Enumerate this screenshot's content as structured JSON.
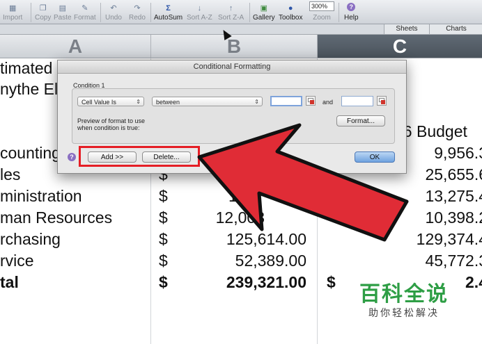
{
  "toolbar": {
    "items": [
      {
        "label": "Import",
        "icon": "import-icon"
      },
      {
        "label": "Copy",
        "icon": "copy-icon"
      },
      {
        "label": "Paste",
        "icon": "paste-icon"
      },
      {
        "label": "Format",
        "icon": "format-brush-icon"
      },
      {
        "label": "Undo",
        "icon": "undo-icon"
      },
      {
        "label": "Redo",
        "icon": "redo-icon"
      },
      {
        "label": "AutoSum",
        "icon": "sigma-icon"
      },
      {
        "label": "Sort A-Z",
        "icon": "sort-az-icon"
      },
      {
        "label": "Sort Z-A",
        "icon": "sort-za-icon"
      },
      {
        "label": "Gallery",
        "icon": "gallery-icon"
      },
      {
        "label": "Toolbox",
        "icon": "toolbox-icon"
      },
      {
        "label": "Zoom",
        "value": "300%"
      },
      {
        "label": "Help",
        "icon": "help-icon"
      }
    ]
  },
  "ribbon_tabs": [
    "Sheets",
    "Charts"
  ],
  "columns": [
    "A",
    "B",
    "C"
  ],
  "sheet": {
    "a_col": [
      "timated",
      "nythe El",
      "counting",
      "les",
      "ministration",
      "man Resources",
      "rchasing",
      "rvice",
      "tal"
    ],
    "b_dollar": "$",
    "b_values": [
      "13,",
      "12,003",
      "125,614.00",
      "52,389.00",
      "239,321.00"
    ],
    "c_header": "06 Budget",
    "c_values": [
      "9,956.3",
      "25,655.6",
      "13,275.4",
      "10,398.2",
      "129,374.4",
      "45,772.3",
      "2.4"
    ]
  },
  "dialog": {
    "title": "Conditional Formatting",
    "condition_label": "Condition 1",
    "type_select": "Cell Value Is",
    "operator_select": "between",
    "value1": "",
    "and_label": "and",
    "value2": "",
    "preview_text_1": "Preview of format to use",
    "preview_text_2": "when condition is true:",
    "format_button": "Format...",
    "add_button": "Add >>",
    "delete_button": "Delete...",
    "ok_button": "OK",
    "help": "?"
  },
  "watermark": {
    "main": "百科全说",
    "sub": "助你轻松解决"
  },
  "colors": {
    "arrow": "#e02c36",
    "highlight": "#e51e25",
    "watermark_green": "#2e9e45",
    "selected_column": "#535c65"
  }
}
